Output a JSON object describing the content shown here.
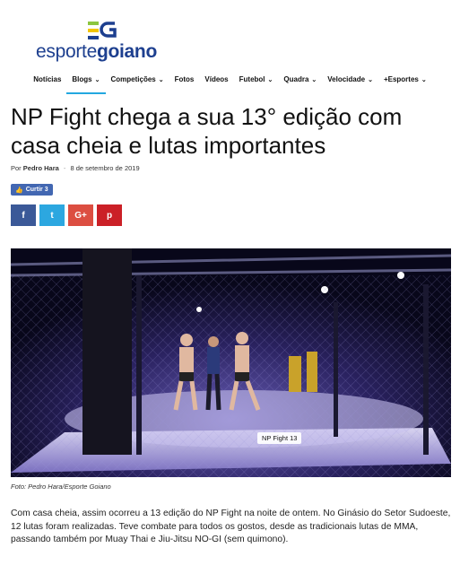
{
  "logo": {
    "brand_light": "esporte",
    "brand_bold": "goiano",
    "colors": {
      "green": "#8cc63f",
      "yellow": "#f2c500",
      "blue": "#1d3f8f"
    }
  },
  "nav": {
    "items": [
      {
        "label": "Notícias",
        "has_dropdown": false,
        "active": false
      },
      {
        "label": "Blogs",
        "has_dropdown": true,
        "active": true
      },
      {
        "label": "Competições",
        "has_dropdown": true,
        "active": false
      },
      {
        "label": "Fotos",
        "has_dropdown": false,
        "active": false
      },
      {
        "label": "Vídeos",
        "has_dropdown": false,
        "active": false
      },
      {
        "label": "Futebol",
        "has_dropdown": true,
        "active": false
      },
      {
        "label": "Quadra",
        "has_dropdown": true,
        "active": false
      },
      {
        "label": "Velocidade",
        "has_dropdown": true,
        "active": false
      },
      {
        "label": "+Esportes",
        "has_dropdown": true,
        "active": false
      }
    ]
  },
  "article": {
    "title": "NP Fight chega a sua 13° edição com casa cheia e lutas importantes",
    "byline_prefix": "Por",
    "author": "Pedro Hara",
    "separator": "-",
    "date": "8 de setembro de 2019",
    "like_label": "Curtir 3",
    "share_icons": [
      "facebook-icon",
      "twitter-icon",
      "google-plus-icon",
      "pinterest-icon"
    ],
    "share_glyphs": {
      "facebook": "f",
      "twitter": "t",
      "google_plus": "G+",
      "pinterest": "p"
    },
    "photo_label": "NP Fight 13",
    "caption": "Foto: Pedro Hara/Esporte Goiano",
    "body": "Com casa cheia, assim ocorreu a 13 edição do NP Fight na noite de ontem. No Ginásio do Setor Sudoeste, 12 lutas foram realizadas. Teve combate para todos os gostos, desde as tradicionais lutas de MMA, passando também por Muay Thai e Jiu-Jitsu NO-GI (sem quimono)."
  }
}
